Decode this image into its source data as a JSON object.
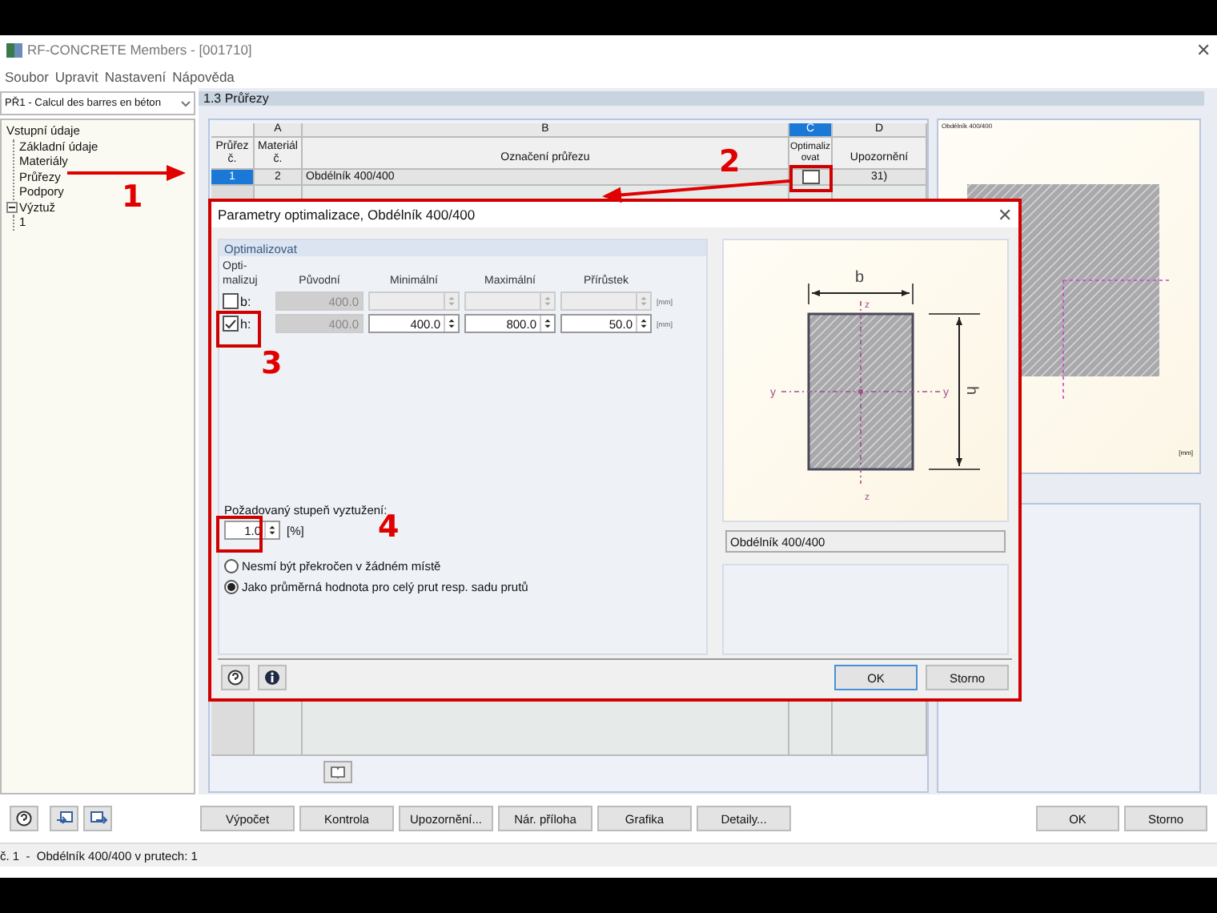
{
  "window": {
    "title": "RF-CONCRETE Members - [001710]",
    "close": "✕"
  },
  "menu": [
    "Soubor",
    "Upravit",
    "Nastavení",
    "Nápověda"
  ],
  "case_select": {
    "value": "PŘ1 - Calcul des barres en béton"
  },
  "tree": [
    {
      "label": "Vstupní údaje",
      "children": [
        {
          "label": "Základní údaje"
        },
        {
          "label": "Materiály"
        },
        {
          "label": "Průřezy"
        },
        {
          "label": "Podpory"
        }
      ]
    },
    {
      "label": "Výztuž",
      "expanded": true,
      "children": [
        {
          "label": "1"
        }
      ]
    }
  ],
  "section_title": "1.3 Průřezy",
  "table": {
    "column_letters": [
      {
        "label": "A",
        "selected": false
      },
      {
        "label": "B",
        "selected": false
      },
      {
        "label": "C",
        "selected": true
      },
      {
        "label": "D",
        "selected": false
      }
    ],
    "columns": [
      "Průřez č.",
      "Materiál č.",
      "Označení průřezu",
      "Optimalizovat",
      "Upozornění"
    ],
    "rows": [
      {
        "number": "1",
        "selected": true,
        "material": "2",
        "name": "Obdélník 400/400",
        "optimize": false,
        "note": "31)"
      }
    ]
  },
  "preview": {
    "title": "Obdélník 400/400",
    "unit": "[mm]"
  },
  "dialog": {
    "title": "Parametry optimalizace, Obdélník 400/400",
    "close": "✕",
    "group": "Optimalizovat",
    "columns": [
      "Opti-malizuj",
      "Původní",
      "Minimální",
      "Maximální",
      "Přírůstek"
    ],
    "rows": [
      {
        "label": "b:",
        "checked": false,
        "original": "400.0",
        "unit": "[mm]"
      },
      {
        "label": "h:",
        "checked": true,
        "original": "400.0",
        "minimum": "400.0",
        "maximum": "800.0",
        "step": "50.0",
        "unit": "[mm]"
      }
    ],
    "reinforcement": {
      "label": "Požadovaný stupeň vyztužení:",
      "value": "1.0",
      "unit": "[%]"
    },
    "options": [
      {
        "label": "Nesmí být překročen v žádném místě",
        "selected": false
      },
      {
        "label": "Jako průměrná hodnota pro celý prut resp. sadu prutů",
        "selected": true
      }
    ],
    "figure": {
      "width_label": "b",
      "height_label": "h",
      "axis_y": [
        "y",
        "y"
      ],
      "axis_z": [
        "z",
        "z"
      ],
      "caption": "Obdélník 400/400"
    },
    "buttons": [
      "OK",
      "Storno"
    ]
  },
  "toolbar_buttons": [
    "Výpočet",
    "Kontrola",
    "Upozornění...",
    "Nár. příloha",
    "Grafika",
    "Detaily..."
  ],
  "window_buttons": [
    "OK",
    "Storno"
  ],
  "status_bar": "č. 1  -  Obdélník 400/400 v prutech: 1",
  "annotations": [
    "1",
    "2",
    "3",
    "4"
  ]
}
